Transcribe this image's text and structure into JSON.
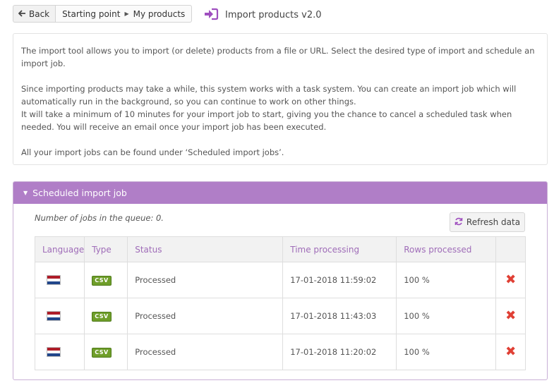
{
  "nav": {
    "back_label": "Back",
    "breadcrumb": [
      "Starting point",
      "My products"
    ],
    "page_title": "Import products v2.0"
  },
  "intro": {
    "para1": "The import tool allows you to import (or delete) products from a file or URL. Select the desired type of import and schedule an import job.",
    "para2": "Since importing products may take a while, this system works with a task system. You can create an import job which will automatically run in the background, so you can continue to work on other things.",
    "para3": "It will take a minimum of 10 minutes for your import job to start, giving you the chance to cancel a scheduled task when needed. You will receive an email once your import job has been executed.",
    "para4": "All your import jobs can be found under ‘Scheduled import jobs’."
  },
  "scheduled": {
    "title": "Scheduled import job",
    "queue_text": "Number of jobs in the queue: 0.",
    "refresh_label": "Refresh data",
    "columns": [
      "Language",
      "Type",
      "Status",
      "Time processing",
      "Rows processed",
      ""
    ],
    "rows": [
      {
        "language": "nl",
        "type": "CSV",
        "status": "Processed",
        "time": "17-01-2018 11:59:02",
        "rows": "100 %"
      },
      {
        "language": "nl",
        "type": "CSV",
        "status": "Processed",
        "time": "17-01-2018 11:43:03",
        "rows": "100 %"
      },
      {
        "language": "nl",
        "type": "CSV",
        "status": "Processed",
        "time": "17-01-2018 11:20:02",
        "rows": "100 %"
      }
    ]
  },
  "colors": {
    "accent": "#b07ec7",
    "header_text": "#9f6cb8",
    "csv_badge": "#6f9e2a",
    "delete": "#e04035",
    "flag": [
      "#ae1c28",
      "#ffffff",
      "#21468b"
    ]
  },
  "icons": {
    "back": "arrow-left-icon",
    "breadcrumb_separator": "caret-right-icon",
    "page": "sign-in-icon",
    "panel_toggle": "caret-down-icon",
    "refresh": "refresh-icon",
    "delete": "delete-x-icon",
    "language": "netherlands-flag-icon"
  }
}
